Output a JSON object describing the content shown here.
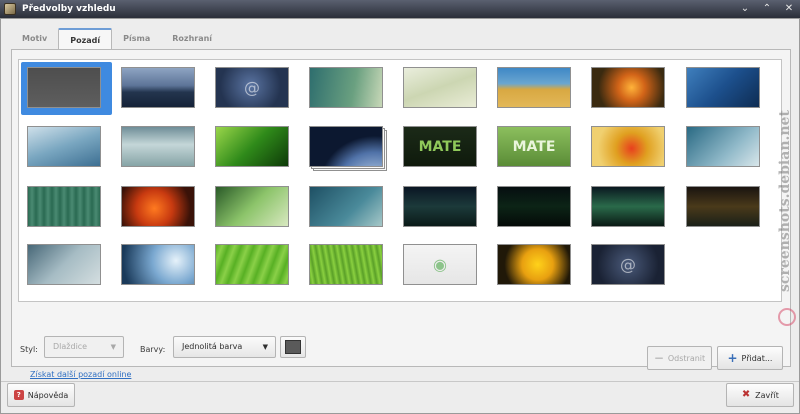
{
  "window": {
    "title": "Předvolby vzhledu",
    "controls": [
      "⌄",
      "⌃",
      "✕"
    ]
  },
  "tabs": [
    {
      "label": "Motiv",
      "active": false
    },
    {
      "label": "Pozadí",
      "active": true
    },
    {
      "label": "Písma",
      "active": false
    },
    {
      "label": "Rozhraní",
      "active": false
    }
  ],
  "wallpapers": [
    {
      "name": "solid-gray",
      "bg": "linear-gradient(#4e4e4e,#5e5e5e)",
      "selected": true
    },
    {
      "name": "sea-dusk",
      "bg": "linear-gradient(#8ea4c2 0%,#5d7498 45%,#23354e 62%,#152238 100%)"
    },
    {
      "name": "debian-swirl-blue",
      "bg": "radial-gradient(circle at 48% 45%,#5a74a2,#243451 70%)",
      "glyph": "@"
    },
    {
      "name": "teal-curve",
      "bg": "linear-gradient(100deg,#2e6e6e,#6aa080 60%,#c8d8b8)"
    },
    {
      "name": "light-fabric",
      "bg": "linear-gradient(160deg,#eaeedd,#ccd6b2 50%,#e9ecd6)"
    },
    {
      "name": "grass-sea",
      "bg": "linear-gradient(#3f88c6 0%,#6aa6d0 40%,#d8a842 55%,#e3b858 100%)"
    },
    {
      "name": "orange-flower",
      "bg": "radial-gradient(circle at 55% 50%,#ffb33a,#d26418 30%,#3a2a10 75%)"
    },
    {
      "name": "blue-drops",
      "bg": "linear-gradient(135deg,#3f7fbd,#1c4f8c 50%,#0e2c52)"
    },
    {
      "name": "blue-waves",
      "bg": "linear-gradient(160deg,#cfe0ea,#79a6c0 50%,#3d6f92)"
    },
    {
      "name": "gray-waves",
      "bg": "linear-gradient(#6f8e98,#c4d6d8 45%,#86a4a6 100%)"
    },
    {
      "name": "green-leaf",
      "bg": "linear-gradient(135deg,#9ad64a,#2f8a1a 50%,#0e3a08)"
    },
    {
      "name": "earth-space",
      "bg": "radial-gradient(ellipse at 90% 150%,#cfe4f8 0%,#5072a8 40%,#0c1830 60%)",
      "stacked": true
    },
    {
      "name": "mate-dark",
      "bg": "linear-gradient(#1b2a18,#0f1a0c)",
      "text": "MATE",
      "textColor": "#8fc85a"
    },
    {
      "name": "mate-green",
      "bg": "linear-gradient(#8cbf5e,#5a8c36)",
      "text": "MATE",
      "textColor": "#eaf5dc"
    },
    {
      "name": "red-flower",
      "bg": "radial-gradient(circle at 55% 55%,#e8401e,#e0a020 35%,#f0d070 75%)"
    },
    {
      "name": "teal-mist",
      "bg": "linear-gradient(135deg,#2a6a84,#8fb8c8 60%,#d8e6ea)"
    },
    {
      "name": "green-stripes",
      "bg": "repeating-linear-gradient(90deg,#2a6a52 0px,#4a8a72 4px,#2a6a52 8px)"
    },
    {
      "name": "orange-flower-2",
      "bg": "radial-gradient(circle at 45% 55%,#ff7a20,#c83a10 40%,#3a1208 80%)"
    },
    {
      "name": "green-stems",
      "bg": "linear-gradient(135deg,#2a5a28,#8cc46a 50%,#d8e8c0)"
    },
    {
      "name": "teal-bokeh",
      "bg": "linear-gradient(135deg,#1e5064,#4a8a9a 60%,#a6c8c8)"
    },
    {
      "name": "aurora-dark",
      "bg": "linear-gradient(#0a1624,#1c3a3a 50%,#0a1a18)"
    },
    {
      "name": "aurora-darker",
      "bg": "linear-gradient(#060e10,#0c2416 50%,#040a08)"
    },
    {
      "name": "aurora-green",
      "bg": "linear-gradient(#0a1820,#2a6a4a 50%,#0a1a14)"
    },
    {
      "name": "aurora-amber",
      "bg": "linear-gradient(#1a1410,#4a3a1a 50%,#1a2018)"
    },
    {
      "name": "gray-curves",
      "bg": "linear-gradient(135deg,#486878,#a6bcc4 50%,#d4dee0)"
    },
    {
      "name": "water-drop",
      "bg": "radial-gradient(circle at 75% 40%,#e6f2fa,#7aa8d0 40%,#1a3a5a 90%)"
    },
    {
      "name": "green-leaf-2",
      "bg": "repeating-linear-gradient(110deg,#58b024 0px,#8ad048 6px,#58b024 12px)"
    },
    {
      "name": "grass-blades",
      "bg": "repeating-linear-gradient(80deg,#5aa028 0px,#8ad040 3px,#5aa028 6px)"
    },
    {
      "name": "light-mate-logo",
      "bg": "linear-gradient(#f4f4f4,#e6e6e6)",
      "glyph": "◉"
    },
    {
      "name": "yellow-flower",
      "bg": "radial-gradient(circle at 55% 50%,#ffd21a,#e8a010 35%,#201808 75%)"
    },
    {
      "name": "debian-dark",
      "bg": "radial-gradient(circle at 50% 50%,#4a5a7a,#1a2234 75%)",
      "glyph": "@"
    }
  ],
  "style": {
    "label": "Styl:",
    "value": "Dlaždice"
  },
  "colors": {
    "label": "Barvy:",
    "value": "Jednolitá barva",
    "swatch": "#5a5a5a"
  },
  "link": "Získat další pozadí online",
  "buttons": {
    "remove": "Odstranit",
    "add": "Přidat...",
    "help": "Nápověda",
    "close": "Zavřít"
  },
  "watermark": "screenshots.debian.net"
}
